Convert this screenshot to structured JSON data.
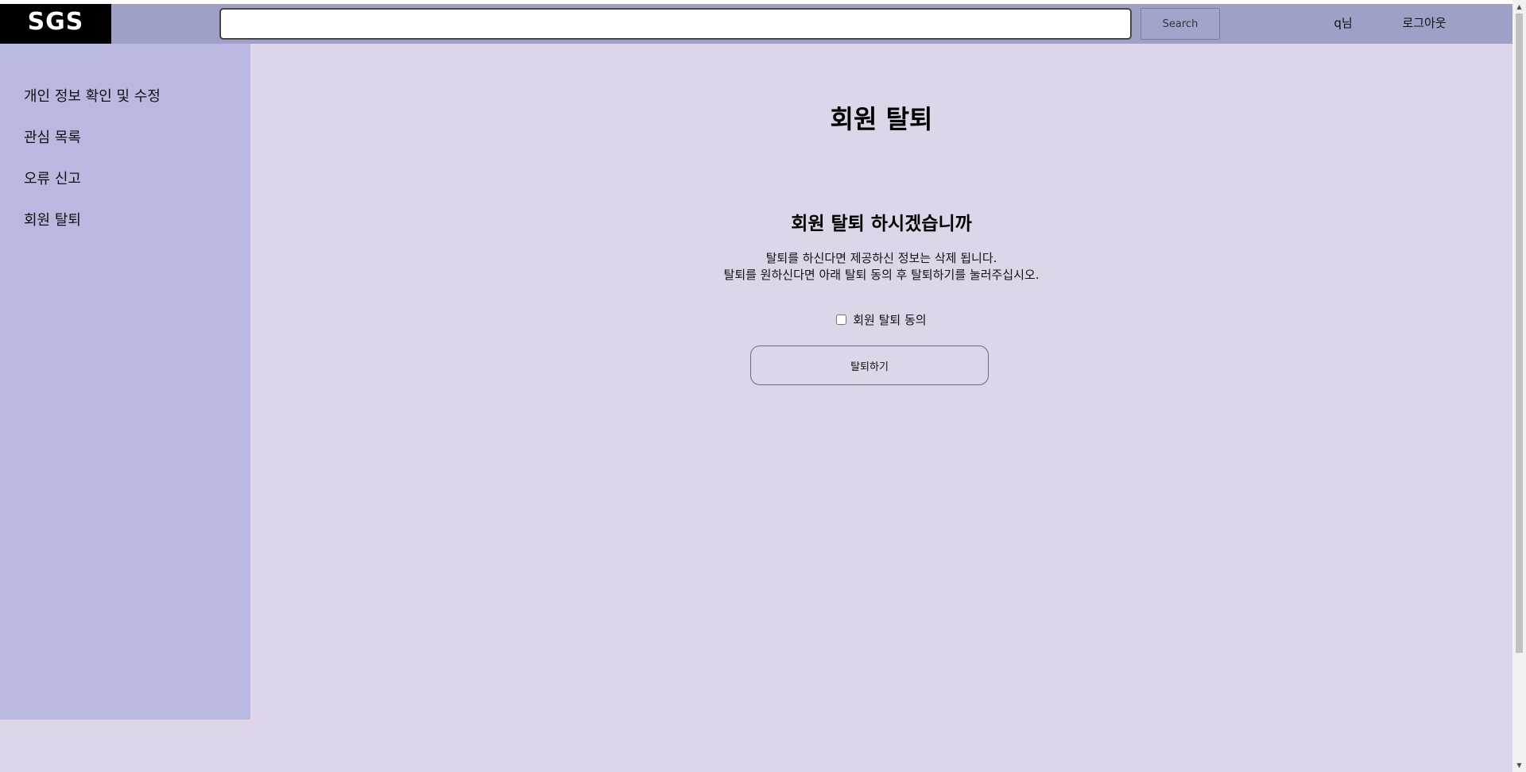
{
  "header": {
    "logo": "SGS",
    "search": {
      "value": "",
      "placeholder": "",
      "button_label": "Search"
    },
    "user_label": "q님",
    "logout_label": "로그아웃"
  },
  "sidebar": {
    "items": [
      {
        "label": "개인 정보 확인 및 수정"
      },
      {
        "label": "관심 목록"
      },
      {
        "label": "오류 신고"
      },
      {
        "label": "회원 탈퇴"
      }
    ]
  },
  "main": {
    "title": "회원 탈퇴",
    "confirm_heading": "회원 탈퇴 하시겠습니까",
    "description_lines": [
      "탈퇴를 하신다면 제공하신 정보는 삭제 됩니다.",
      "탈퇴를 원하신다면 아래 탈퇴 동의 후 탈퇴하기를 눌러주십시오."
    ],
    "agree_checkbox": {
      "label": "회원 탈퇴 동의",
      "checked": false
    },
    "withdraw_button_label": "탈퇴하기"
  },
  "colors": {
    "topbar": "#9fa0c8",
    "sidebar": "#b8b8e0",
    "main_background": "#dcd6e8",
    "logo_background": "#000000",
    "logo_text": "#ffffff"
  }
}
